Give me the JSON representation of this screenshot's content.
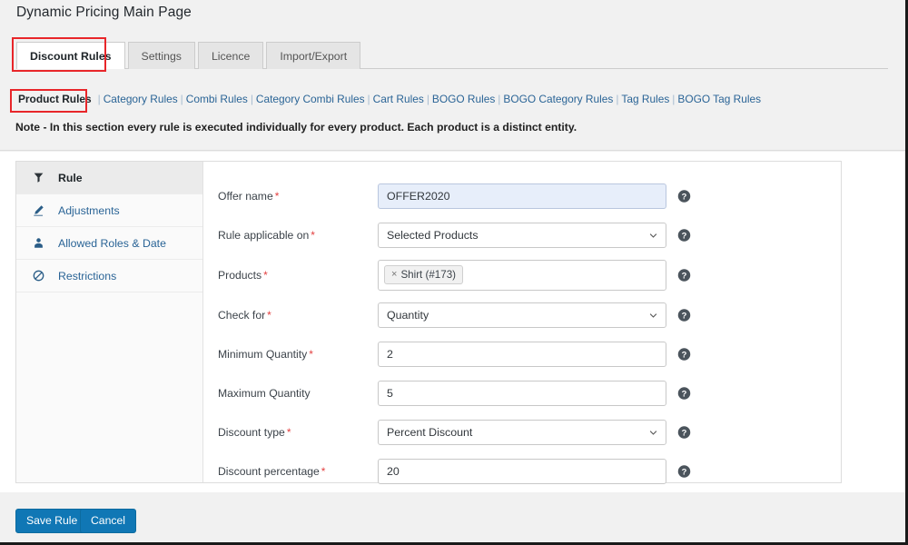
{
  "page": {
    "title": "Dynamic Pricing Main Page",
    "note": "Note - In this section every rule is executed individually for every product. Each product is a distinct entity."
  },
  "tabs": [
    {
      "label": "Discount Rules",
      "active": true
    },
    {
      "label": "Settings",
      "active": false
    },
    {
      "label": "Licence",
      "active": false
    },
    {
      "label": "Import/Export",
      "active": false
    }
  ],
  "subnav": [
    {
      "label": "Product Rules",
      "current": true
    },
    {
      "label": "Category Rules",
      "current": false
    },
    {
      "label": "Combi Rules",
      "current": false
    },
    {
      "label": "Category Combi Rules",
      "current": false
    },
    {
      "label": "Cart Rules",
      "current": false
    },
    {
      "label": "BOGO Rules",
      "current": false
    },
    {
      "label": "BOGO Category Rules",
      "current": false
    },
    {
      "label": "Tag Rules",
      "current": false
    },
    {
      "label": "BOGO Tag Rules",
      "current": false
    }
  ],
  "sidebar": {
    "items": [
      {
        "label": "Rule",
        "icon": "filter-icon",
        "active": true
      },
      {
        "label": "Adjustments",
        "icon": "pencil-icon",
        "active": false
      },
      {
        "label": "Allowed Roles & Date",
        "icon": "user-icon",
        "active": false
      },
      {
        "label": "Restrictions",
        "icon": "ban-icon",
        "active": false
      }
    ]
  },
  "form": {
    "fields": [
      {
        "label": "Offer name",
        "required": true,
        "type": "text",
        "value": "OFFER2020",
        "focused": true
      },
      {
        "label": "Rule applicable on",
        "required": true,
        "type": "select",
        "value": "Selected Products"
      },
      {
        "label": "Products",
        "required": true,
        "type": "chips",
        "chips": [
          "Shirt (#173)"
        ],
        "chip_remove": "×"
      },
      {
        "label": "Check for",
        "required": true,
        "type": "select",
        "value": "Quantity"
      },
      {
        "label": "Minimum Quantity",
        "required": true,
        "type": "text",
        "value": "2"
      },
      {
        "label": "Maximum Quantity",
        "required": false,
        "type": "text",
        "value": "5"
      },
      {
        "label": "Discount type",
        "required": true,
        "type": "select",
        "value": "Percent Discount"
      },
      {
        "label": "Discount percentage",
        "required": true,
        "type": "text",
        "value": "20"
      }
    ],
    "required_marker": "*",
    "help_icon": "help-icon"
  },
  "footer": {
    "save_label": "Save Rule",
    "cancel_label": "Cancel"
  },
  "colors": {
    "accent_blue": "#1077b5",
    "link_blue": "#2a6496",
    "annotation_red": "#e8262a",
    "required_red": "#e34040",
    "focus_bg": "#e7eefa"
  }
}
